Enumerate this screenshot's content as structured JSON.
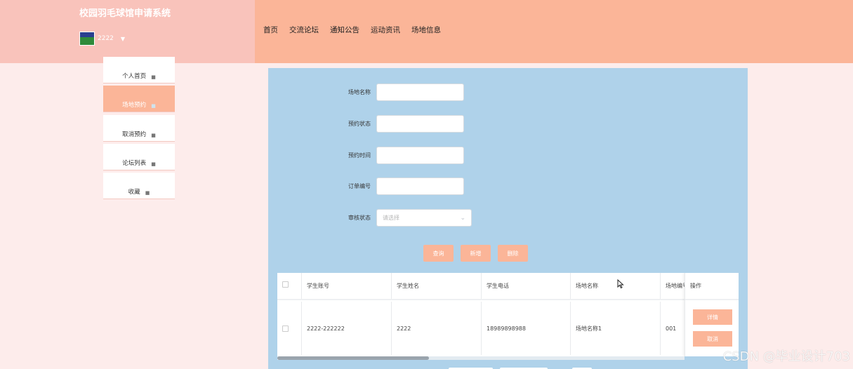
{
  "app": {
    "title": "校园羽毛球馆申请系统",
    "username": "2222"
  },
  "nav": [
    "首页",
    "交流论坛",
    "通知公告",
    "运动资讯",
    "场地信息"
  ],
  "sidebar": {
    "items": [
      {
        "label": "个人首页"
      },
      {
        "label": "场地预约"
      },
      {
        "label": "取消预约"
      },
      {
        "label": "论坛列表"
      },
      {
        "label": "收藏"
      }
    ],
    "active_index": 1
  },
  "search_form": {
    "fields": [
      {
        "label": "场地名称",
        "value": ""
      },
      {
        "label": "预约状态",
        "value": ""
      },
      {
        "label": "预约时间",
        "value": ""
      },
      {
        "label": "订单编号",
        "value": ""
      }
    ],
    "status_select": {
      "label": "审核状态",
      "placeholder": "请选择"
    },
    "buttons": {
      "query": "查询",
      "add": "新增",
      "delete": "删除"
    }
  },
  "table": {
    "columns": [
      "学生账号",
      "学生姓名",
      "学生电话",
      "场地名称",
      "场地编号"
    ],
    "op_header": "操作",
    "rows": [
      {
        "cells": [
          "2222-222222",
          "2222",
          "18989898988",
          "场地名称1",
          "001"
        ]
      }
    ],
    "row_actions": {
      "detail": "详情",
      "cancel": "取消"
    }
  },
  "watermark": "CSDN @毕业设计703",
  "colors": {
    "header_left": "#f9c3bb",
    "header_right": "#fbb598",
    "panel": "#afd2ea",
    "accent": "#fbb598",
    "page_bg": "#fdeceb"
  }
}
